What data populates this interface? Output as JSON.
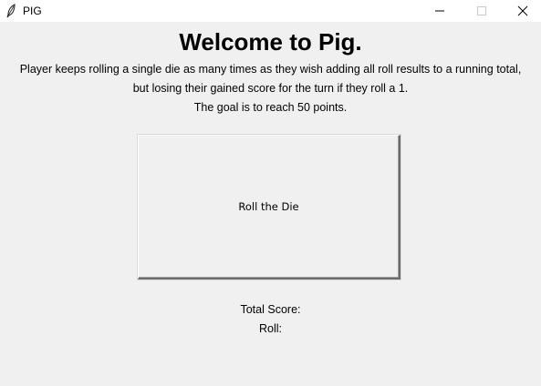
{
  "window": {
    "title": "PIG",
    "icon": "feather-icon",
    "controls": {
      "minimize": "minimize-icon",
      "maximize": "maximize-icon",
      "close": "close-icon"
    }
  },
  "main": {
    "heading": "Welcome to Pig.",
    "description": [
      "Player keeps rolling a single die as many times as they wish adding all roll results to a running total,",
      "but losing their gained score for the turn if they roll a 1.",
      "The goal is to reach 50 points."
    ],
    "roll_button_label": "Roll the Die",
    "total_score_label": "Total Score:",
    "roll_label": "Roll:"
  }
}
